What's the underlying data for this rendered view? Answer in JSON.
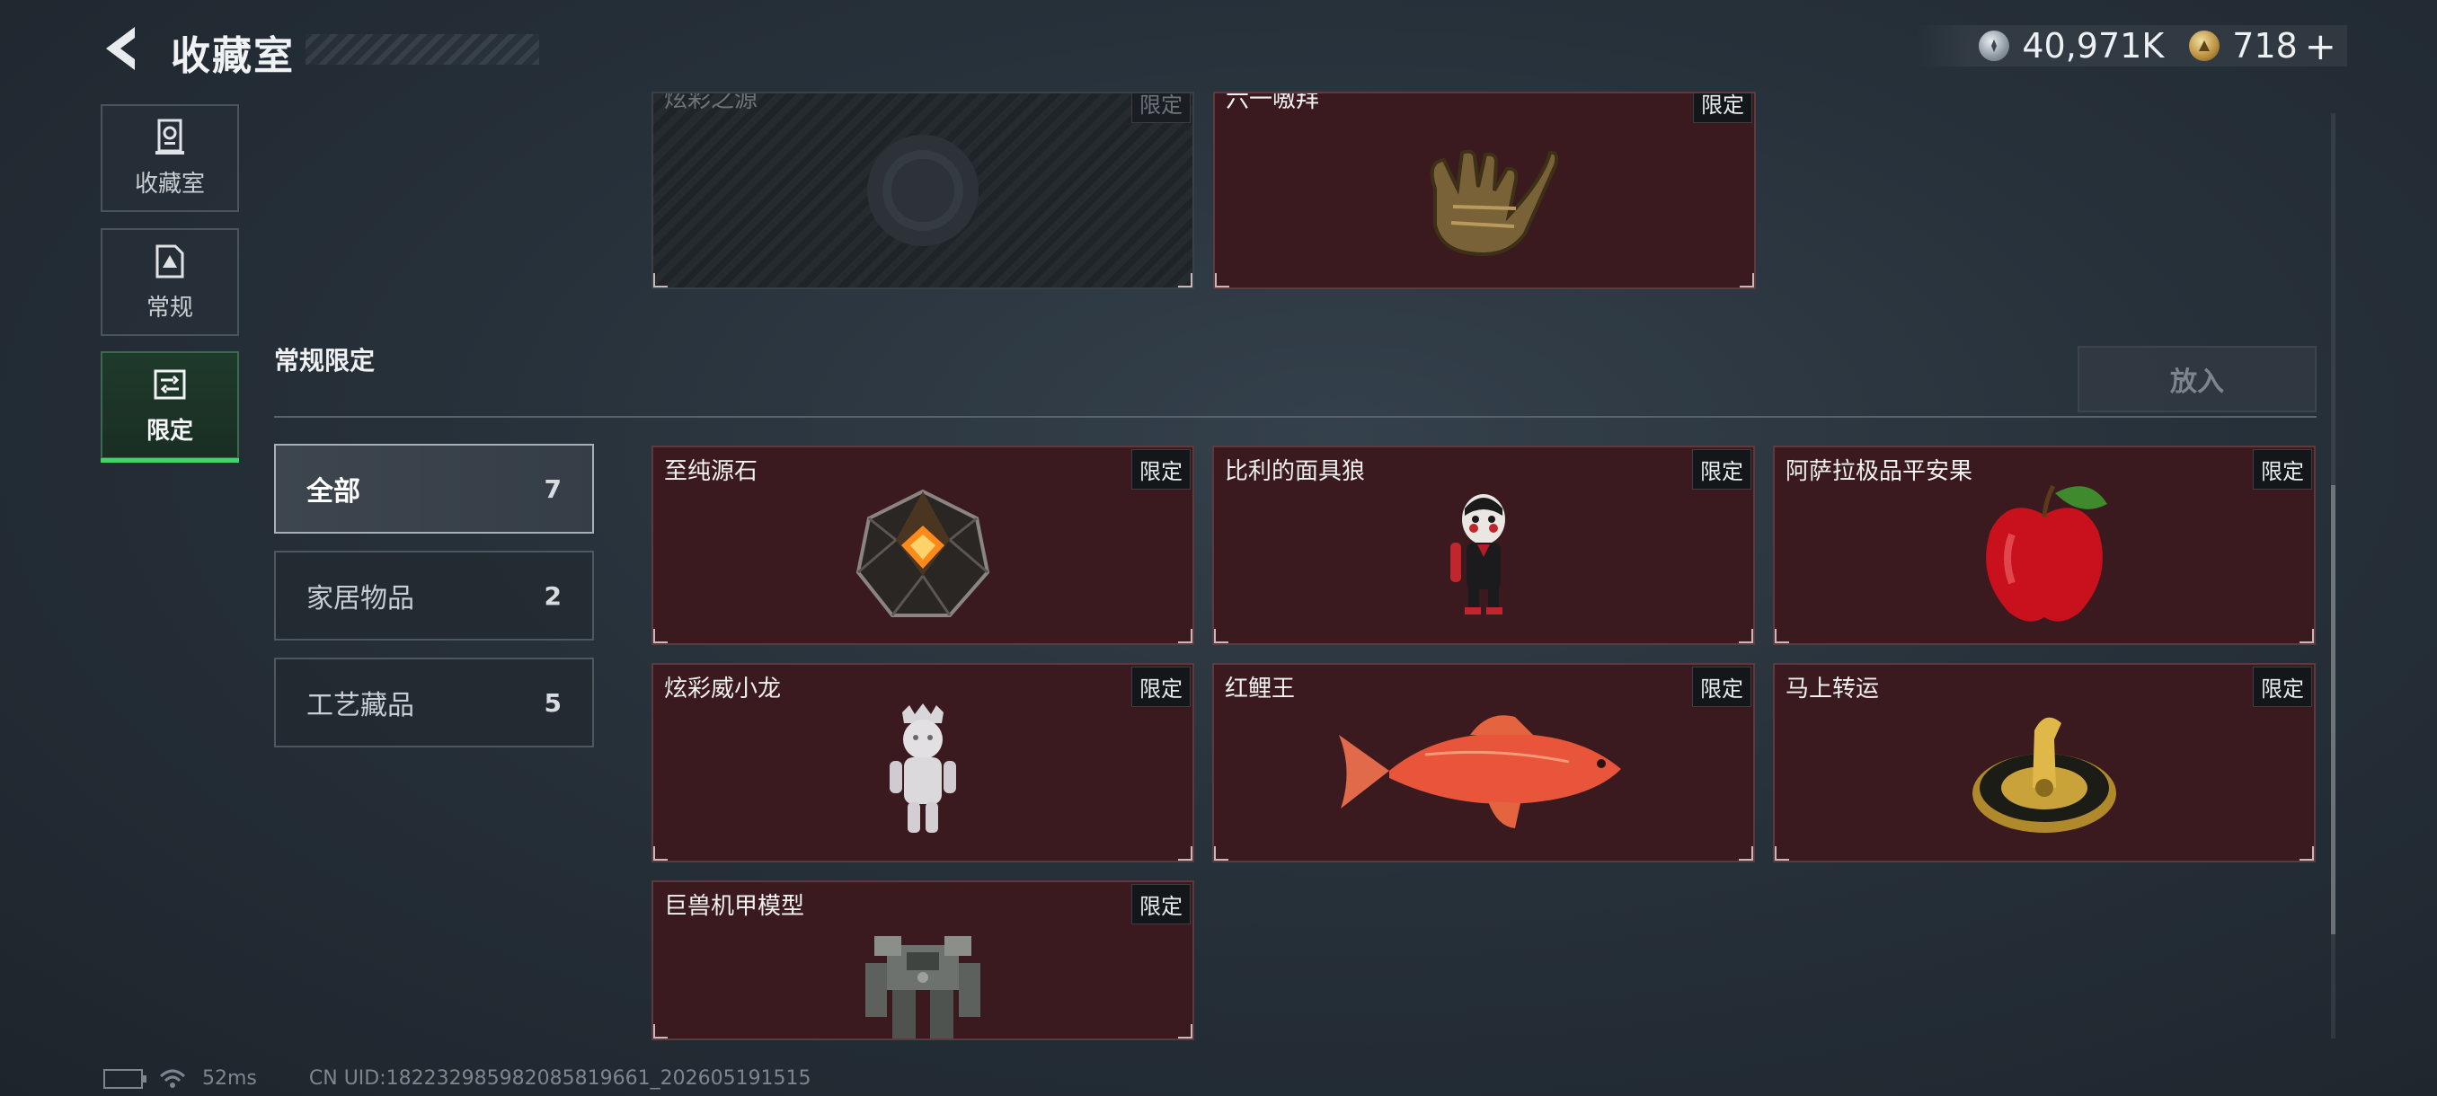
{
  "header": {
    "title": "收藏室",
    "currencies": [
      {
        "icon": "silver-coin-icon",
        "value": "40,971K"
      },
      {
        "icon": "gold-coin-icon",
        "value": "718",
        "plus": "+"
      }
    ]
  },
  "nav": {
    "tabs": [
      {
        "label": "收藏室",
        "icon": "trophy-cabinet-icon",
        "active": false
      },
      {
        "label": "常规",
        "icon": "document-icon",
        "active": false
      },
      {
        "label": "限定",
        "icon": "limited-frame-icon",
        "active": true
      }
    ]
  },
  "top_row": {
    "cards": [
      {
        "name": "炫彩之源",
        "badge": "限定",
        "locked": true
      },
      {
        "name": "六一嗷拜",
        "badge": "限定",
        "icon": "glove-icon"
      }
    ]
  },
  "section": {
    "title": "常规限定",
    "put_button": "放入"
  },
  "filters": [
    {
      "label": "全部",
      "count": "7",
      "active": true
    },
    {
      "label": "家居物品",
      "count": "2",
      "active": false
    },
    {
      "label": "工艺藏品",
      "count": "5",
      "active": false
    }
  ],
  "items": [
    {
      "name": "至纯源石",
      "badge": "限定",
      "icon": "source-stone-icon"
    },
    {
      "name": "比利的面具狼",
      "badge": "限定",
      "icon": "puppet-figure-icon"
    },
    {
      "name": "阿萨拉极品平安果",
      "badge": "限定",
      "icon": "apple-icon"
    },
    {
      "name": "炫彩威小龙",
      "badge": "限定",
      "icon": "white-figurine-icon"
    },
    {
      "name": "红鲤王",
      "badge": "限定",
      "icon": "koi-fish-icon"
    },
    {
      "name": "马上转运",
      "badge": "限定",
      "icon": "golden-horse-coin-icon"
    },
    {
      "name": "巨兽机甲模型",
      "badge": "限定",
      "icon": "mech-model-icon"
    }
  ],
  "footer": {
    "ping": "52ms",
    "uid": "CN UID:18223298598208581966​1_202605191515"
  },
  "colors": {
    "accent": "#43d36b",
    "card_bg": "#3a1a1e",
    "page_bg": "#27313a"
  }
}
